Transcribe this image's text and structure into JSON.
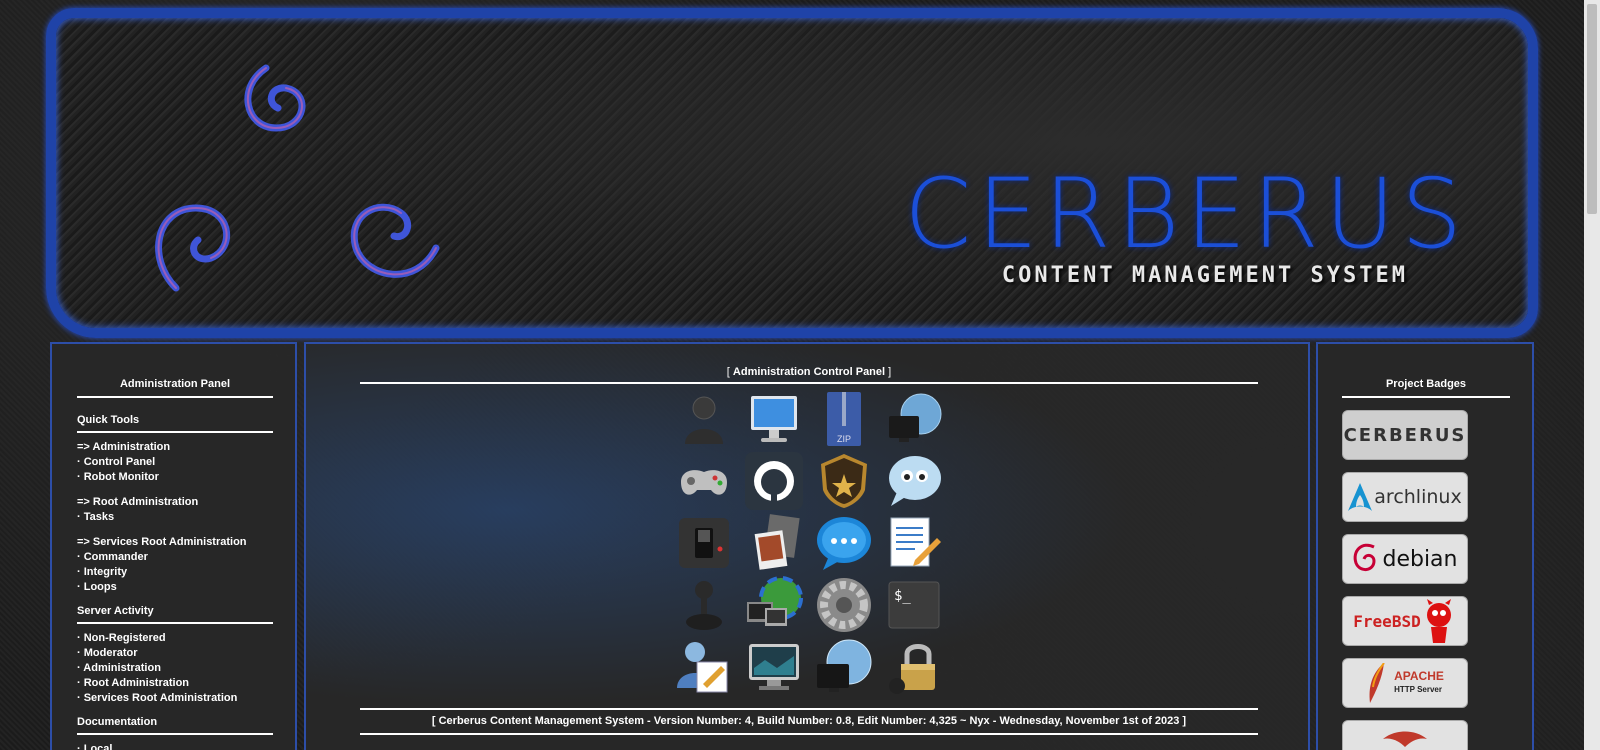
{
  "banner": {
    "title": "CERBERUS",
    "subtitle": "CONTENT MANAGEMENT SYSTEM"
  },
  "left_panel": {
    "heading": "Administration Panel",
    "quick_tools": {
      "heading": "Quick Tools",
      "groups": [
        [
          "=> Administration",
          "· Control Panel",
          "· Robot Monitor"
        ],
        [
          "=> Root Administration",
          "· Tasks"
        ],
        [
          "=> Services Root Administration",
          "· Commander",
          "· Integrity",
          "· Loops"
        ]
      ]
    },
    "server_activity": {
      "heading": "Server Activity",
      "items": [
        "· Non-Registered",
        "· Moderator",
        "· Administration",
        "· Root Administration",
        "· Services Root Administration"
      ]
    },
    "documentation": {
      "heading": "Documentation",
      "items": [
        "· Local"
      ]
    }
  },
  "main_panel": {
    "title_prefix": "[ ",
    "title": "Administration Control Panel",
    "title_suffix": " ]",
    "icons": [
      "user-icon",
      "monitor-icon",
      "zip-archive-icon",
      "network-globe-icon",
      "gamepad-icon",
      "github-icon",
      "security-badge-icon",
      "chat-bubble-icon",
      "switch-icon",
      "photos-icon",
      "message-icon",
      "text-editor-icon",
      "joystick-icon",
      "globe-computers-icon",
      "settings-gear-icon",
      "terminal-icon",
      "users-edit-icon",
      "display-icon",
      "globe-monitor-icon",
      "lock-icon"
    ],
    "terminal_prompt": "$_",
    "zip_label": "ZIP",
    "footer": "[ Cerberus Content Management System - Version Number: 4, Build Number: 0.8, Edit Number: 4,325 ~ Nyx - Wednesday, November 1st of 2023 ]"
  },
  "right_panel": {
    "heading": "Project Badges",
    "badges": [
      {
        "name": "cerberus",
        "label": "CERBERUS"
      },
      {
        "name": "archlinux",
        "label": "archlinux"
      },
      {
        "name": "debian",
        "label": "debian"
      },
      {
        "name": "freebsd",
        "label": "FreeBSD"
      },
      {
        "name": "apache",
        "label": "APACHE",
        "sub": "HTTP Server"
      }
    ]
  },
  "colors": {
    "accent_blue": "#1f43a8",
    "text": "#ffffff",
    "panel_bg": "#282828"
  }
}
